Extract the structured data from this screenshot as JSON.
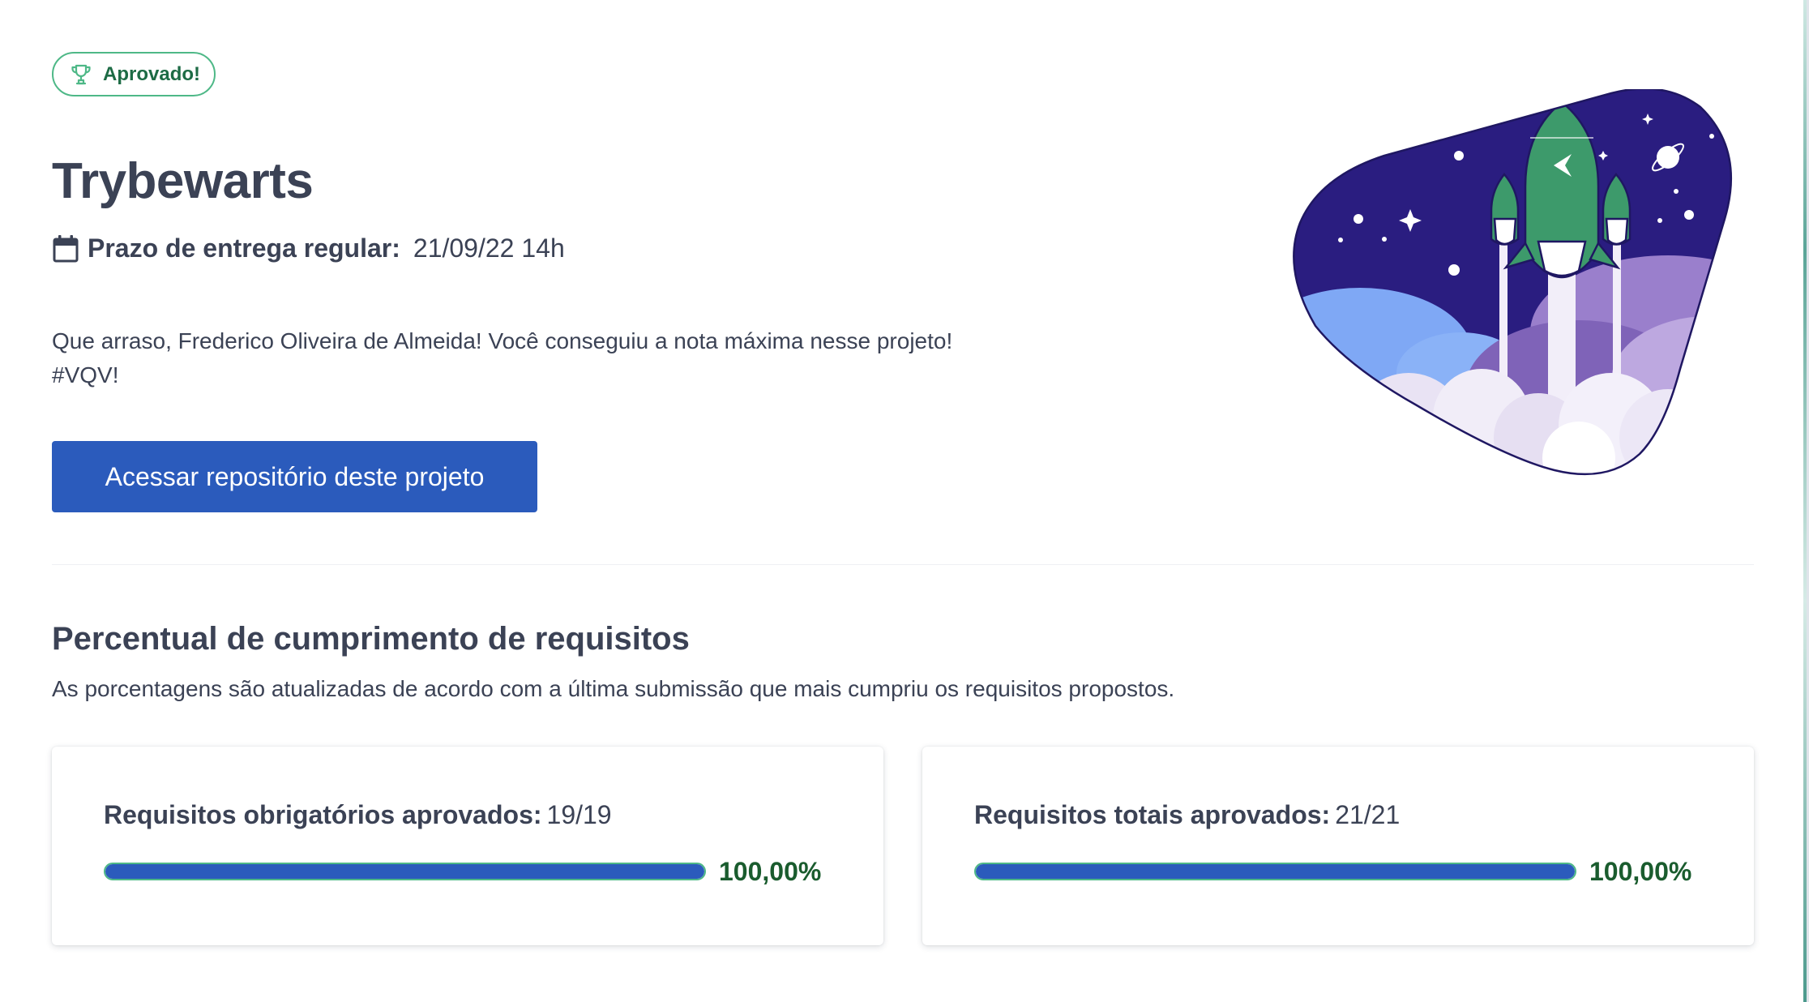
{
  "status_badge": {
    "label": "Aprovado!",
    "icon": "trophy-icon",
    "color": "#4eb887"
  },
  "project": {
    "title": "Trybewarts",
    "deadline_label": "Prazo de entrega regular:",
    "deadline_value": "21/09/22 14h",
    "message_line1": "Que arraso, Frederico Oliveira de Almeida! Você conseguiu a nota máxima nesse projeto!",
    "message_line2": "#VQV!",
    "repo_button": "Acessar repositório deste projeto"
  },
  "requirements": {
    "title": "Percentual de cumprimento de requisitos",
    "subtitle": "As porcentagens são atualizadas de acordo com a última submissão que mais cumpriu os requisitos propostos.",
    "cards": [
      {
        "label": "Requisitos obrigatórios aprovados:",
        "value": "19/19",
        "percent_text": "100,00%",
        "progress": 1.0
      },
      {
        "label": "Requisitos totais aprovados:",
        "value": "21/21",
        "percent_text": "100,00%",
        "progress": 1.0
      }
    ]
  },
  "colors": {
    "accent_blue": "#2b5bbc",
    "success_green": "#4eb887",
    "success_text": "#1a5c2e",
    "text_dark": "#3b4255",
    "illustration_bg": "#2a1d80"
  }
}
